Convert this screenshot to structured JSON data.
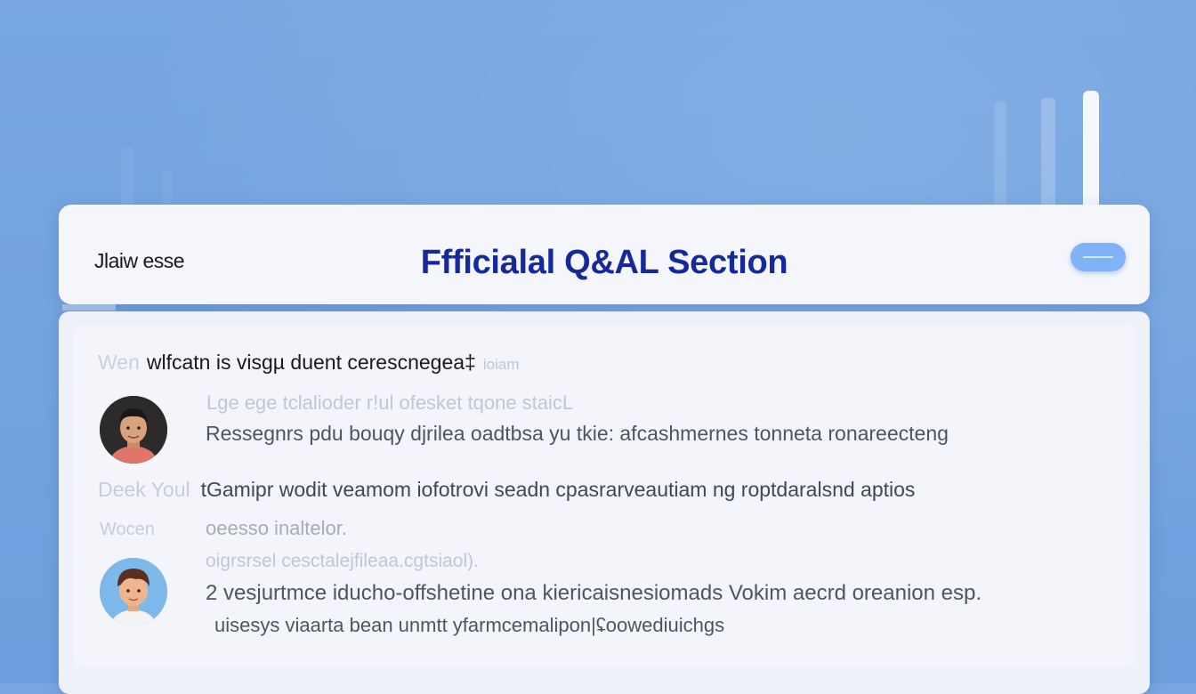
{
  "header": {
    "brand": "Jlaiw esse",
    "title": "Ffficialal Q&AL Section",
    "toggle_icon": "toggle-switch-icon"
  },
  "question_1": {
    "prefix": "Wen",
    "text": "wlfcatn is visgµ duent cerescnegea‡",
    "suffix": "ioiam"
  },
  "answer_1": {
    "avatar": "user-avatar-icon",
    "subtitle": "Lge ege tclalioder r!ul ofesket tqone staicL",
    "text": "Ressegnrs pdu bouqy djrilea oadtbsa yu tkie: afcashmernes tonneta ronareecteng"
  },
  "question_2": {
    "prefix": "Deek Youl",
    "text": "tGamipr wodit veamom iofotrovi seadn cpasrarveautiam ng roptdaralsnd aptios"
  },
  "answer_2": {
    "side_label": "Wocen",
    "avatar": "user-avatar-icon",
    "subtitle1": "oeesso inaltelor.",
    "subtitle2": "oigrsrsel cesctalejfileaa.cgtsiaol).",
    "text": "2 vesjurtmce iducho-offshetine ona kiericaisnesiomads Vokim aecrd oreanion esp.",
    "tail": "uisesys viaarta bean unmtt yfarmcemalipon|ʢoowediuichgs"
  },
  "colors": {
    "background": "#77a6e2",
    "title": "#15299a",
    "toggle": "#7fb3f5",
    "card": "#f4f6fb"
  }
}
